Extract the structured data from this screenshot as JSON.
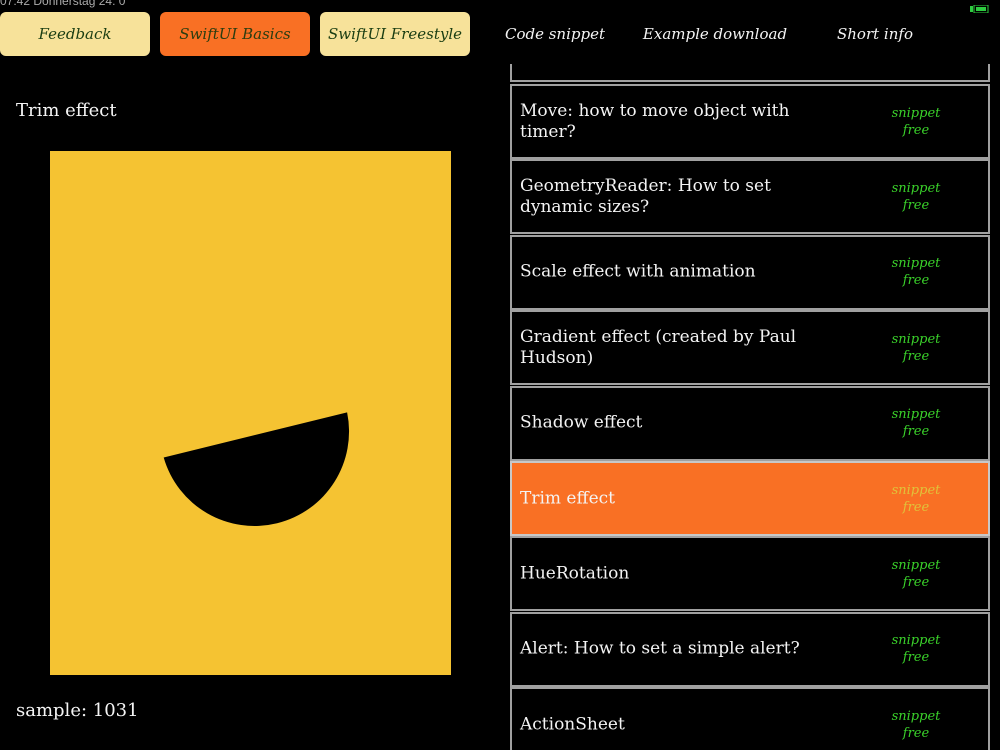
{
  "status_bar": {
    "text": "07:42   Donnerstag 24. 0"
  },
  "nav": {
    "feedback": "Feedback",
    "swiftui_basics": "SwiftUI Basics",
    "swiftui_freestyle": "SwiftUI Freestyle",
    "code_snippet": "Code snippet",
    "example_download": "Example download",
    "short_info": "Short info"
  },
  "left": {
    "title": "Trim effect",
    "sample": "sample: 1031"
  },
  "colors": {
    "accent_orange": "#F97024",
    "nav_yellow": "#F7E29A",
    "canvas_yellow": "#F5C332",
    "tag_green": "#3ad12a"
  },
  "list": {
    "items": [
      {
        "title": "Move: how to move object with timer?",
        "tag1": "snippet",
        "tag2": "free",
        "selected": false
      },
      {
        "title": "GeometryReader: How to set dynamic sizes?",
        "tag1": "snippet",
        "tag2": "free",
        "selected": false
      },
      {
        "title": "Scale effect with animation",
        "tag1": "snippet",
        "tag2": "free",
        "selected": false
      },
      {
        "title": "Gradient effect (created by Paul Hudson)",
        "tag1": "snippet",
        "tag2": "free",
        "selected": false
      },
      {
        "title": "Shadow effect",
        "tag1": "snippet",
        "tag2": "free",
        "selected": false
      },
      {
        "title": "Trim effect",
        "tag1": "snippet",
        "tag2": "free",
        "selected": true
      },
      {
        "title": "HueRotation",
        "tag1": "snippet",
        "tag2": "free",
        "selected": false
      },
      {
        "title": "Alert: How to set a simple alert?",
        "tag1": "snippet",
        "tag2": "free",
        "selected": false
      },
      {
        "title": "ActionSheet",
        "tag1": "snippet",
        "tag2": "free",
        "selected": false
      }
    ]
  }
}
